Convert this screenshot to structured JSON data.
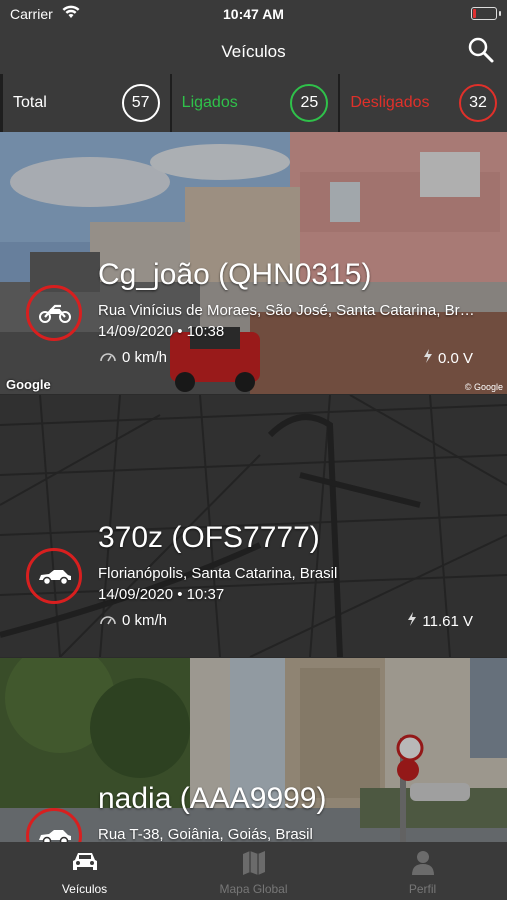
{
  "status_bar": {
    "carrier": "Carrier",
    "time": "10:47 AM"
  },
  "nav": {
    "title": "Veículos"
  },
  "summary": [
    {
      "label": "Total",
      "count": "57",
      "color": "#ffffff"
    },
    {
      "label": "Ligados",
      "count": "25",
      "color": "#2fc14a"
    },
    {
      "label": "Desligados",
      "count": "32",
      "color": "#e0302a"
    }
  ],
  "vehicles": [
    {
      "name": "Cg_joão  (QHN0315)",
      "address": "Rua Vinícius de Moraes, São José, Santa Catarina, Brasil",
      "datetime": "14/09/2020 • 10:38",
      "speed": "0 km/h",
      "voltage": "0.0 V",
      "icon": "motorcycle-icon",
      "background": "street-view"
    },
    {
      "name": "370z (OFS7777)",
      "address": "Florianópolis, Santa Catarina, Brasil",
      "datetime": "14/09/2020 • 10:37",
      "speed": "0 km/h",
      "voltage": "11.61 V",
      "icon": "car-icon",
      "background": "map"
    },
    {
      "name": "nadia (AAA9999)",
      "address": "Rua T-38, Goiânia, Goiás, Brasil",
      "datetime": "",
      "speed": "",
      "voltage": "",
      "icon": "car-icon",
      "background": "street-view"
    }
  ],
  "attribution": {
    "google": "Google",
    "copyright": "© Google"
  },
  "tabs": [
    {
      "label": "Veículos",
      "active": true
    },
    {
      "label": "Mapa Global",
      "active": false
    },
    {
      "label": "Perfil",
      "active": false
    }
  ],
  "colors": {
    "accent_red": "#d81f1f",
    "on_green": "#2fc14a",
    "off_red": "#e0302a",
    "bar_bg": "#3a3a3a"
  }
}
